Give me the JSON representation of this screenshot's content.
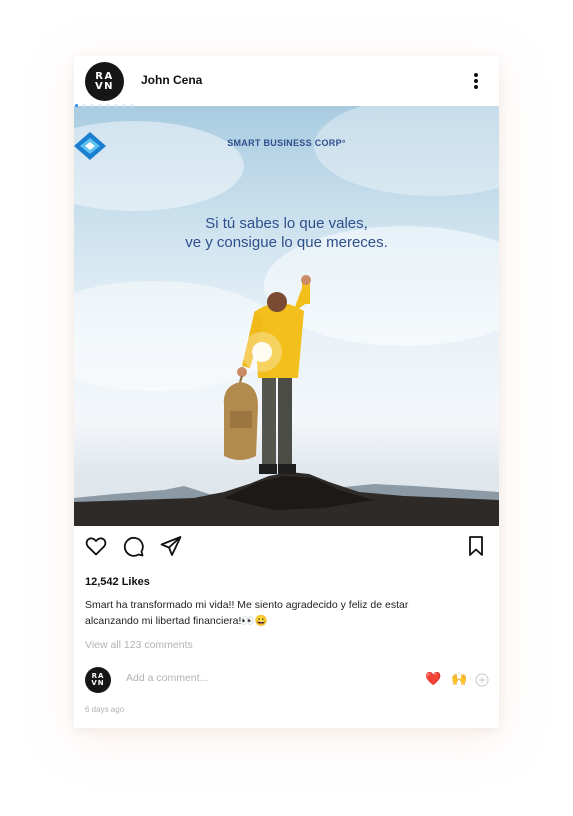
{
  "post": {
    "author": {
      "avatar_text_top": "RA",
      "avatar_text_bottom": "VN",
      "username": "John Cena"
    },
    "carousel": {
      "count": 8,
      "active_index": 0
    },
    "image": {
      "brand_name": "SMART BUSINESS CORP°",
      "quote_line1": "Si tú sabes lo que vales,",
      "quote_line2": "ve y consigue lo que mereces."
    },
    "actions": {
      "like_icon": "heart-icon",
      "comment_icon": "comment-icon",
      "share_icon": "send-icon",
      "save_icon": "bookmark-icon"
    },
    "likes": "12,542 Likes",
    "caption_line1": "Smart ha transformado mi vida!! Me siento agradecido y feliz de estar",
    "caption_line2": "alcanzando mi libertad financiera!👀😀",
    "view_comments": "View all 123 comments",
    "comment_placeholder": "Add a comment...",
    "quick_emojis": [
      "❤️",
      "🙌"
    ],
    "timestamp": "6 days ago"
  },
  "colors": {
    "accent": "#2d8cf0",
    "brand_text": "#2e4f8c",
    "muted_text": "#b3b3b3",
    "avatar_bg": "#161616"
  }
}
